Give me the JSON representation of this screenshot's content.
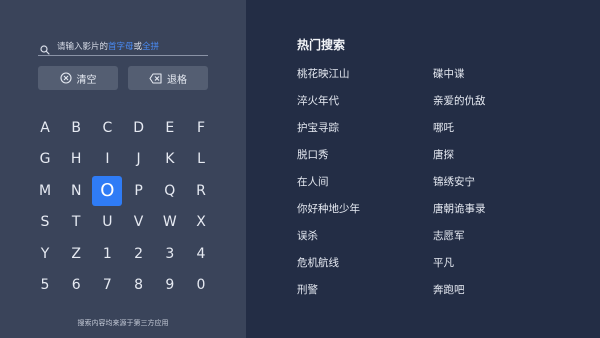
{
  "search": {
    "prefix": "请输入影片的",
    "highlight1": "首字母",
    "middle": "或",
    "highlight2": "全拼"
  },
  "buttons": {
    "clear_label": "清空",
    "backspace_label": "退格"
  },
  "keyboard": {
    "rows": [
      [
        "A",
        "B",
        "C",
        "D",
        "E",
        "F"
      ],
      [
        "G",
        "H",
        "I",
        "J",
        "K",
        "L"
      ],
      [
        "M",
        "N",
        "O",
        "P",
        "Q",
        "R"
      ],
      [
        "S",
        "T",
        "U",
        "V",
        "W",
        "X"
      ],
      [
        "Y",
        "Z",
        "1",
        "2",
        "3",
        "4"
      ],
      [
        "5",
        "6",
        "7",
        "8",
        "9",
        "0"
      ]
    ],
    "selected": "O"
  },
  "footer_note": "搜索内容均来源于第三方应用",
  "hot_search": {
    "title": "热门搜索",
    "left": [
      "桃花映江山",
      "淬火年代",
      "护宝寻踪",
      "脱口秀",
      "在人间",
      "你好种地少年",
      "误杀",
      "危机航线",
      "刑警"
    ],
    "right": [
      "碟中谍",
      "亲爱的仇敌",
      "哪吒",
      "唐探",
      "锦绣安宁",
      "唐朝诡事录",
      "志愿军",
      "平凡",
      "奔跑吧"
    ]
  },
  "colors": {
    "left_panel": "#3a445a",
    "right_panel": "#232d45",
    "accent": "#2f7cf6",
    "highlight_text": "#4a8df8"
  }
}
